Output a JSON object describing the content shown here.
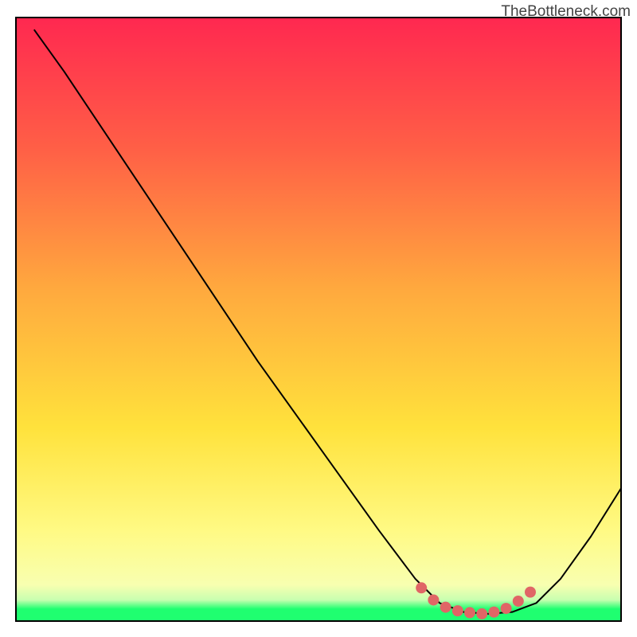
{
  "watermark": "TheBottleneck.com",
  "chart_data": {
    "type": "line",
    "title": "",
    "xlabel": "",
    "ylabel": "",
    "xlim": [
      0,
      100
    ],
    "ylim": [
      0,
      100
    ],
    "gradient_colors": {
      "top": "#ff2850",
      "mid_upper": "#ff7748",
      "mid": "#ffe23c",
      "mid_lower": "#fffa84",
      "bottom": "#1fff70"
    },
    "series": [
      {
        "name": "main-curve",
        "color": "#000000",
        "points": [
          {
            "x": 3,
            "y": 98
          },
          {
            "x": 8,
            "y": 91
          },
          {
            "x": 14,
            "y": 82
          },
          {
            "x": 20,
            "y": 73
          },
          {
            "x": 30,
            "y": 58
          },
          {
            "x": 40,
            "y": 43
          },
          {
            "x": 50,
            "y": 29
          },
          {
            "x": 60,
            "y": 15
          },
          {
            "x": 66,
            "y": 7
          },
          {
            "x": 70,
            "y": 3
          },
          {
            "x": 74,
            "y": 1.5
          },
          {
            "x": 78,
            "y": 1.2
          },
          {
            "x": 82,
            "y": 1.5
          },
          {
            "x": 86,
            "y": 3
          },
          {
            "x": 90,
            "y": 7
          },
          {
            "x": 95,
            "y": 14
          },
          {
            "x": 100,
            "y": 22
          }
        ]
      },
      {
        "name": "highlight-dots",
        "color": "#e06666",
        "points": [
          {
            "x": 67,
            "y": 5.5
          },
          {
            "x": 69,
            "y": 3.5
          },
          {
            "x": 71,
            "y": 2.3
          },
          {
            "x": 73,
            "y": 1.7
          },
          {
            "x": 75,
            "y": 1.4
          },
          {
            "x": 77,
            "y": 1.2
          },
          {
            "x": 79,
            "y": 1.5
          },
          {
            "x": 81,
            "y": 2.1
          },
          {
            "x": 83,
            "y": 3.3
          },
          {
            "x": 85,
            "y": 4.8
          }
        ]
      }
    ]
  }
}
